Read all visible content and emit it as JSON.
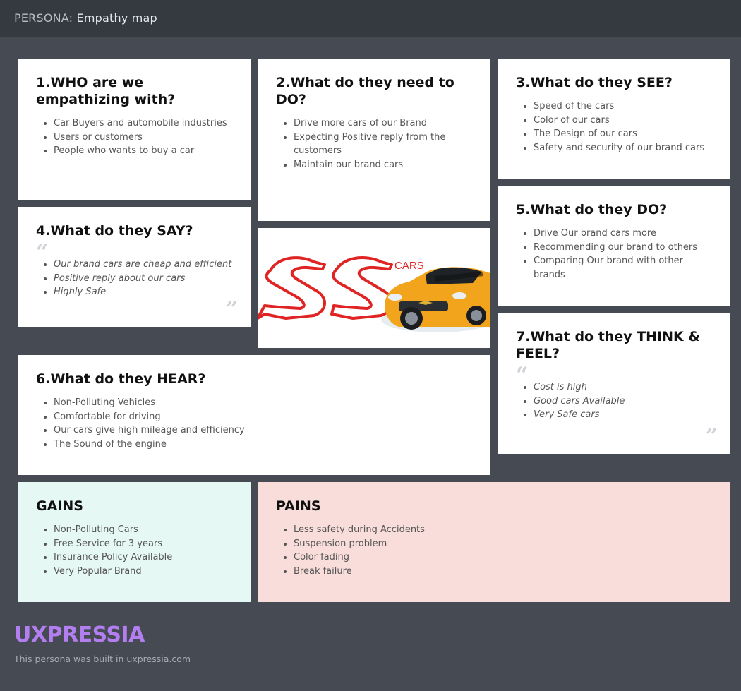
{
  "header": {
    "prefix": "PERSONA:",
    "title": "Empathy map"
  },
  "cards": {
    "who": {
      "title": "1.WHO are we empathizing with?",
      "items": [
        "Car Buyers and automobile industries",
        "Users or customers",
        "People who wants to buy a car"
      ]
    },
    "need": {
      "title": "2.What do they need to DO?",
      "items": [
        "Drive more cars of our Brand",
        "Expecting Positive reply from the customers",
        "Maintain our brand cars"
      ]
    },
    "see": {
      "title": "3.What do they SEE?",
      "items": [
        "Speed of the cars",
        "Color of our cars",
        "The Design of our cars",
        "Safety and security of our brand cars"
      ]
    },
    "say": {
      "title": "4.What do they SAY?",
      "items": [
        "Our brand cars are cheap and efficient",
        "Positive reply about our cars",
        "Highly Safe"
      ]
    },
    "do": {
      "title": "5.What do they DO?",
      "items": [
        "Drive Our brand cars more",
        "Recommending our brand to others",
        "Comparing Our brand with other brands"
      ]
    },
    "hear": {
      "title": "6.What do they HEAR?",
      "items": [
        "Non-Polluting Vehicles",
        "Comfortable for driving",
        "Our cars give high mileage and efficiency",
        "The Sound of the engine"
      ]
    },
    "think": {
      "title": "7.What do they THINK & FEEL?",
      "items": [
        "Cost is high",
        "Good cars Available",
        "Very Safe cars"
      ]
    },
    "gains": {
      "title": "GAINS",
      "items": [
        "Non-Polluting Cars",
        "Free Service for 3 years",
        "Insurance Policy Available",
        "Very Popular Brand"
      ]
    },
    "pains": {
      "title": "PAINS",
      "items": [
        "Less safety during Accidents",
        "Suspension problem",
        "Color fading",
        "Break failure"
      ]
    }
  },
  "image_card": {
    "logo_text": "CARS"
  },
  "footer": {
    "brand": "UXPRESSIA",
    "note": "This persona was built in uxpressia.com"
  },
  "colors": {
    "background": "#454a53",
    "topbar": "#353a41",
    "gains": "#e6f8f4",
    "pains": "#f9dddb",
    "brand": "#b37ef0",
    "logo_red": "#e02424",
    "car_yellow": "#f2a51c"
  }
}
